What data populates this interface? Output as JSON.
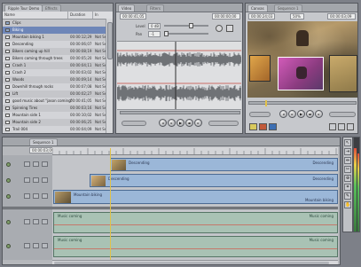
{
  "browser": {
    "tabs": [
      "Ripple Tour Demo",
      "Effects"
    ],
    "columns": [
      "Name",
      "Duration",
      "In"
    ],
    "items": [
      {
        "name": "Clips",
        "type": "bin",
        "duration": "",
        "in": ""
      },
      {
        "name": "Biking",
        "type": "bin",
        "duration": "",
        "in": ""
      },
      {
        "name": "Mountain biking 1",
        "type": "clip",
        "duration": "00:00:12;29",
        "in": "Not Set"
      },
      {
        "name": "Descending",
        "type": "clip",
        "duration": "00:00:06;07",
        "in": "Not Set"
      },
      {
        "name": "Bikers coming up hill",
        "type": "clip",
        "duration": "00:00:08;19",
        "in": "Not Set"
      },
      {
        "name": "Bikers coming through trees",
        "type": "clip",
        "duration": "00:00:05;20",
        "in": "Not Set"
      },
      {
        "name": "Crash 1",
        "type": "clip",
        "duration": "00:00:04;11",
        "in": "Not Set"
      },
      {
        "name": "Crash 2",
        "type": "clip",
        "duration": "00:00:03;02",
        "in": "Not Set"
      },
      {
        "name": "Woods",
        "type": "clip",
        "duration": "00:00:09;14",
        "in": "Not Set"
      },
      {
        "name": "Downhill through rocks",
        "type": "clip",
        "duration": "00:00:07;08",
        "in": "Not Set"
      },
      {
        "name": "Lift",
        "type": "clip",
        "duration": "00:00:02;27",
        "in": "Not Set"
      },
      {
        "name": "good music about \"jason coming\"",
        "type": "clip",
        "duration": "00:00:41;05",
        "in": "Not Set"
      },
      {
        "name": "Spinning Tires",
        "type": "clip",
        "duration": "00:00:03;16",
        "in": "Not Set"
      },
      {
        "name": "Mountain side 1",
        "type": "clip",
        "duration": "00:00:10;02",
        "in": "Not Set"
      },
      {
        "name": "Mountain side 2",
        "type": "clip",
        "duration": "00:00:06;25",
        "in": "Not Set"
      },
      {
        "name": "Trail 004",
        "type": "clip",
        "duration": "00:00:04;09",
        "in": "Not Set"
      },
      {
        "name": "Sequence 1",
        "type": "clip",
        "duration": "00:00:24;03",
        "in": "Not Set"
      }
    ]
  },
  "viewer": {
    "tabs": [
      "Video",
      "Filters"
    ],
    "timecode_duration": "00:00:41;05",
    "timecode_current": "00:00:00;00",
    "level_label": "Level",
    "pan_label": "Pan",
    "level_value": "0 dB",
    "pan_value": "-1"
  },
  "canvas": {
    "tabs": [
      "Canvas",
      "Sequence 1"
    ],
    "timecode_duration": "00:00:24;03",
    "timecode_current": "00:00:03;09",
    "zoom": "50%"
  },
  "timeline": {
    "tabs": [
      "Sequence 1"
    ],
    "timecode": "00:00:03;09",
    "tracks": [
      {
        "id": "V3",
        "clip": "Descending"
      },
      {
        "id": "V2",
        "clip": "Descending"
      },
      {
        "id": "V1",
        "clip": "Mountain biking 1"
      },
      {
        "id": "A1",
        "clip": "Music coming"
      },
      {
        "id": "A2",
        "clip": "Music coming"
      }
    ],
    "clip_labels": {
      "v3_left": "Descending",
      "v3_right": "Descending",
      "v2_left": "Descending",
      "v2_right": "Descending",
      "v1_left": "Mountain biking",
      "v1_right": "Mountain biking",
      "a1_left": "Music coming",
      "a1_right": "Music coming",
      "a2_left": "Music coming",
      "a2_right": "Music coming"
    },
    "track_ids": [
      "V3",
      "V2",
      "V1",
      "A1",
      "A2"
    ]
  },
  "tools": [
    "arrow",
    "select",
    "ripple",
    "razor",
    "zoom",
    "crop",
    "pen",
    "hand"
  ],
  "colors": {
    "video_clip": "#9bb7d8",
    "audio_clip": "#a9c2b4",
    "selection": "#6e86b8",
    "panel": "#c6c8cc"
  }
}
